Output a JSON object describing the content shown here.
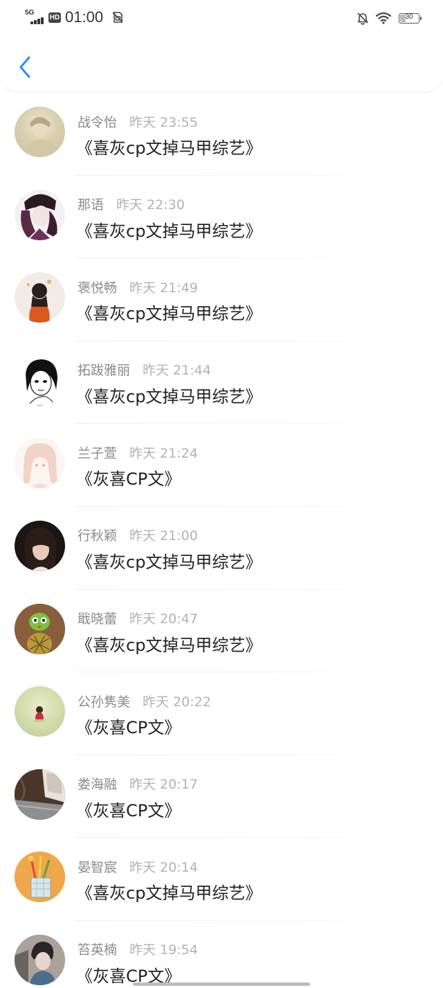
{
  "status_bar": {
    "network": "5G",
    "hd_label": "HD",
    "time": "01:00",
    "battery_level": "30",
    "battery_fraction": 0.3
  },
  "header": {
    "back_icon": "chevron-left-icon",
    "accent_color": "#2d8cf0"
  },
  "comments": [
    {
      "name": "战令怡",
      "time": "昨天 23:55",
      "text": "《喜灰cp文掉马甲综艺》",
      "avatar": "avatar-1"
    },
    {
      "name": "那语",
      "time": "昨天 22:30",
      "text": "《喜灰cp文掉马甲综艺》",
      "avatar": "avatar-2"
    },
    {
      "name": "褒悦畅",
      "time": "昨天 21:49",
      "text": "《喜灰cp文掉马甲综艺》",
      "avatar": "avatar-3"
    },
    {
      "name": "拓跋雅丽",
      "time": "昨天 21:44",
      "text": "《喜灰cp文掉马甲综艺》",
      "avatar": "avatar-4"
    },
    {
      "name": "兰子萱",
      "time": "昨天 21:24",
      "text": "《灰喜CP文》",
      "avatar": "avatar-5"
    },
    {
      "name": "行秋颖",
      "time": "昨天 21:00",
      "text": "《喜灰cp文掉马甲综艺》",
      "avatar": "avatar-6"
    },
    {
      "name": "戢晓蕾",
      "time": "昨天 20:47",
      "text": "《喜灰cp文掉马甲综艺》",
      "avatar": "avatar-7"
    },
    {
      "name": "公孙隽美",
      "time": "昨天 20:22",
      "text": "《灰喜CP文》",
      "avatar": "avatar-8"
    },
    {
      "name": "娄海融",
      "time": "昨天 20:17",
      "text": "《灰喜CP文》",
      "avatar": "avatar-9"
    },
    {
      "name": "晏智宸",
      "time": "昨天 20:14",
      "text": "《喜灰cp文掉马甲综艺》",
      "avatar": "avatar-10"
    },
    {
      "name": "笞英楠",
      "time": "昨天 19:54",
      "text": "《灰喜CP文》",
      "avatar": "avatar-11"
    }
  ]
}
